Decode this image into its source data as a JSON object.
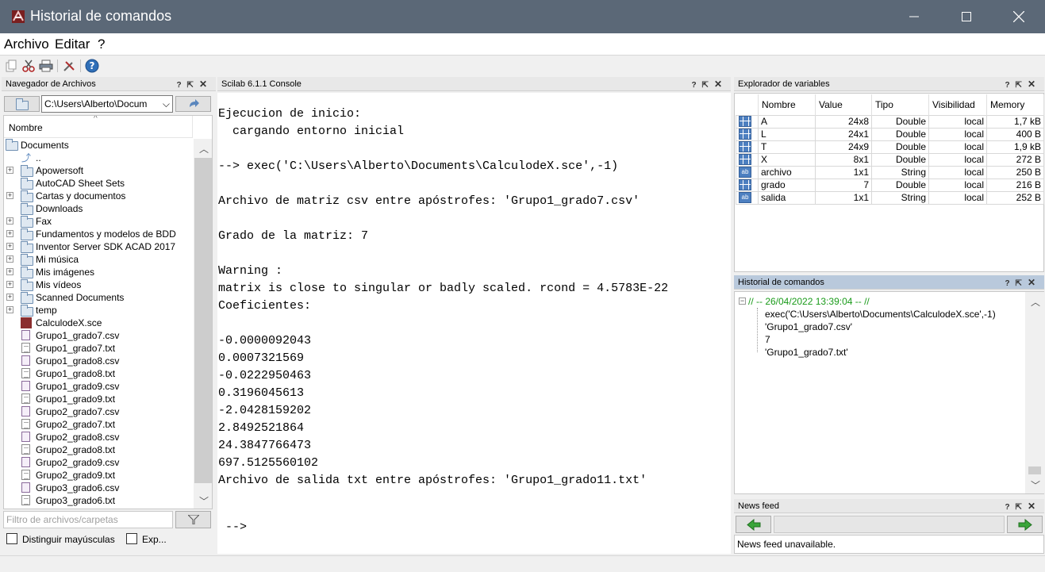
{
  "window": {
    "title": "Historial de comandos",
    "minimize": "─",
    "maximize": "☐",
    "close": "✕"
  },
  "menu": [
    "Archivo",
    "Editar",
    "?"
  ],
  "file_browser": {
    "title": "Navegador de Archivos",
    "path": "C:\\Users\\Alberto\\Docum",
    "column": "Nombre",
    "root": "Documents",
    "items": [
      {
        "name": "..",
        "kind": "up"
      },
      {
        "name": "Apowersoft",
        "kind": "folder",
        "expand": true
      },
      {
        "name": "AutoCAD Sheet Sets",
        "kind": "folder",
        "expand": false
      },
      {
        "name": "Cartas y documentos",
        "kind": "folder",
        "expand": true
      },
      {
        "name": "Downloads",
        "kind": "folder",
        "expand": false
      },
      {
        "name": "Fax",
        "kind": "folder",
        "expand": true
      },
      {
        "name": "Fundamentos y modelos de BDD",
        "kind": "folder",
        "expand": true
      },
      {
        "name": "Inventor Server SDK ACAD 2017",
        "kind": "folder",
        "expand": true
      },
      {
        "name": "Mi música",
        "kind": "folder",
        "expand": true
      },
      {
        "name": "Mis imágenes",
        "kind": "folder",
        "expand": true
      },
      {
        "name": "Mis vídeos",
        "kind": "folder",
        "expand": true
      },
      {
        "name": "Scanned Documents",
        "kind": "folder",
        "expand": true
      },
      {
        "name": "temp",
        "kind": "folder",
        "expand": true
      },
      {
        "name": "CalculodeX.sce",
        "kind": "sce"
      },
      {
        "name": "Grupo1_grado7.csv",
        "kind": "csv"
      },
      {
        "name": "Grupo1_grado7.txt",
        "kind": "txt"
      },
      {
        "name": "Grupo1_grado8.csv",
        "kind": "csv"
      },
      {
        "name": "Grupo1_grado8.txt",
        "kind": "txt"
      },
      {
        "name": "Grupo1_grado9.csv",
        "kind": "csv"
      },
      {
        "name": "Grupo1_grado9.txt",
        "kind": "txt"
      },
      {
        "name": "Grupo2_grado7.csv",
        "kind": "csv"
      },
      {
        "name": "Grupo2_grado7.txt",
        "kind": "txt"
      },
      {
        "name": "Grupo2_grado8.csv",
        "kind": "csv"
      },
      {
        "name": "Grupo2_grado8.txt",
        "kind": "txt"
      },
      {
        "name": "Grupo2_grado9.csv",
        "kind": "csv"
      },
      {
        "name": "Grupo2_grado9.txt",
        "kind": "txt"
      },
      {
        "name": "Grupo3_grado6.csv",
        "kind": "csv"
      },
      {
        "name": "Grupo3_grado6.txt",
        "kind": "txt"
      }
    ],
    "filter_placeholder": "Filtro de archivos/carpetas",
    "case_checkbox": "Distinguir mayúsculas",
    "exp_checkbox": "Exp..."
  },
  "console": {
    "title": "Scilab 6.1.1 Console",
    "lines": [
      "Ejecucion de inicio:",
      "  cargando entorno inicial",
      "",
      "--> exec('C:\\Users\\Alberto\\Documents\\CalculodeX.sce',-1)",
      "",
      "Archivo de matriz csv entre apóstrofes: 'Grupo1_grado7.csv'",
      "",
      "Grado de la matriz: 7",
      "",
      "Warning :",
      "matrix is close to singular or badly scaled. rcond = 4.5783E-22",
      "Coeficientes:",
      "",
      "-0.0000092043",
      "0.0007321569",
      "-0.0222950463",
      "0.3196045613",
      "-2.0428159202",
      "2.8492521864",
      "24.3847766473",
      "697.5125560102",
      "Archivo de salida txt entre apóstrofes: 'Grupo1_grado11.txt'"
    ],
    "prompt": " -->"
  },
  "variables": {
    "title": "Explorador de variables",
    "columns": [
      "Nombre",
      "Value",
      "Tipo",
      "Visibilidad",
      "Memory"
    ],
    "rows": [
      {
        "icon": "matrix",
        "name": "A",
        "value": "24x8",
        "type": "Double",
        "vis": "local",
        "mem": "1,7 kB"
      },
      {
        "icon": "matrix",
        "name": "L",
        "value": "24x1",
        "type": "Double",
        "vis": "local",
        "mem": "400 B"
      },
      {
        "icon": "matrix",
        "name": "T",
        "value": "24x9",
        "type": "Double",
        "vis": "local",
        "mem": "1,9 kB"
      },
      {
        "icon": "matrix",
        "name": "X",
        "value": "8x1",
        "type": "Double",
        "vis": "local",
        "mem": "272 B"
      },
      {
        "icon": "string",
        "name": "archivo",
        "value": "1x1",
        "type": "String",
        "vis": "local",
        "mem": "250 B"
      },
      {
        "icon": "matrix",
        "name": "grado",
        "value": "7",
        "type": "Double",
        "vis": "local",
        "mem": "216 B"
      },
      {
        "icon": "string",
        "name": "salida",
        "value": "1x1",
        "type": "String",
        "vis": "local",
        "mem": "252 B"
      }
    ]
  },
  "history": {
    "title": "Historial de comandos",
    "session": "// -- 26/04/2022 13:39:04 -- //",
    "entries": [
      "exec('C:\\Users\\Alberto\\Documents\\CalculodeX.sce',-1)",
      "'Grupo1_grado7.csv'",
      "7",
      "'Grupo1_grado7.txt'"
    ]
  },
  "news": {
    "title": "News feed",
    "message": "News feed unavailable."
  },
  "panel_controls": {
    "help": "?",
    "undock": "⇱",
    "close": "✕"
  },
  "colors": {
    "titlebar": "#5b6877",
    "history_session": "#1a9b1a",
    "arrow_green": "#3aa53a"
  }
}
